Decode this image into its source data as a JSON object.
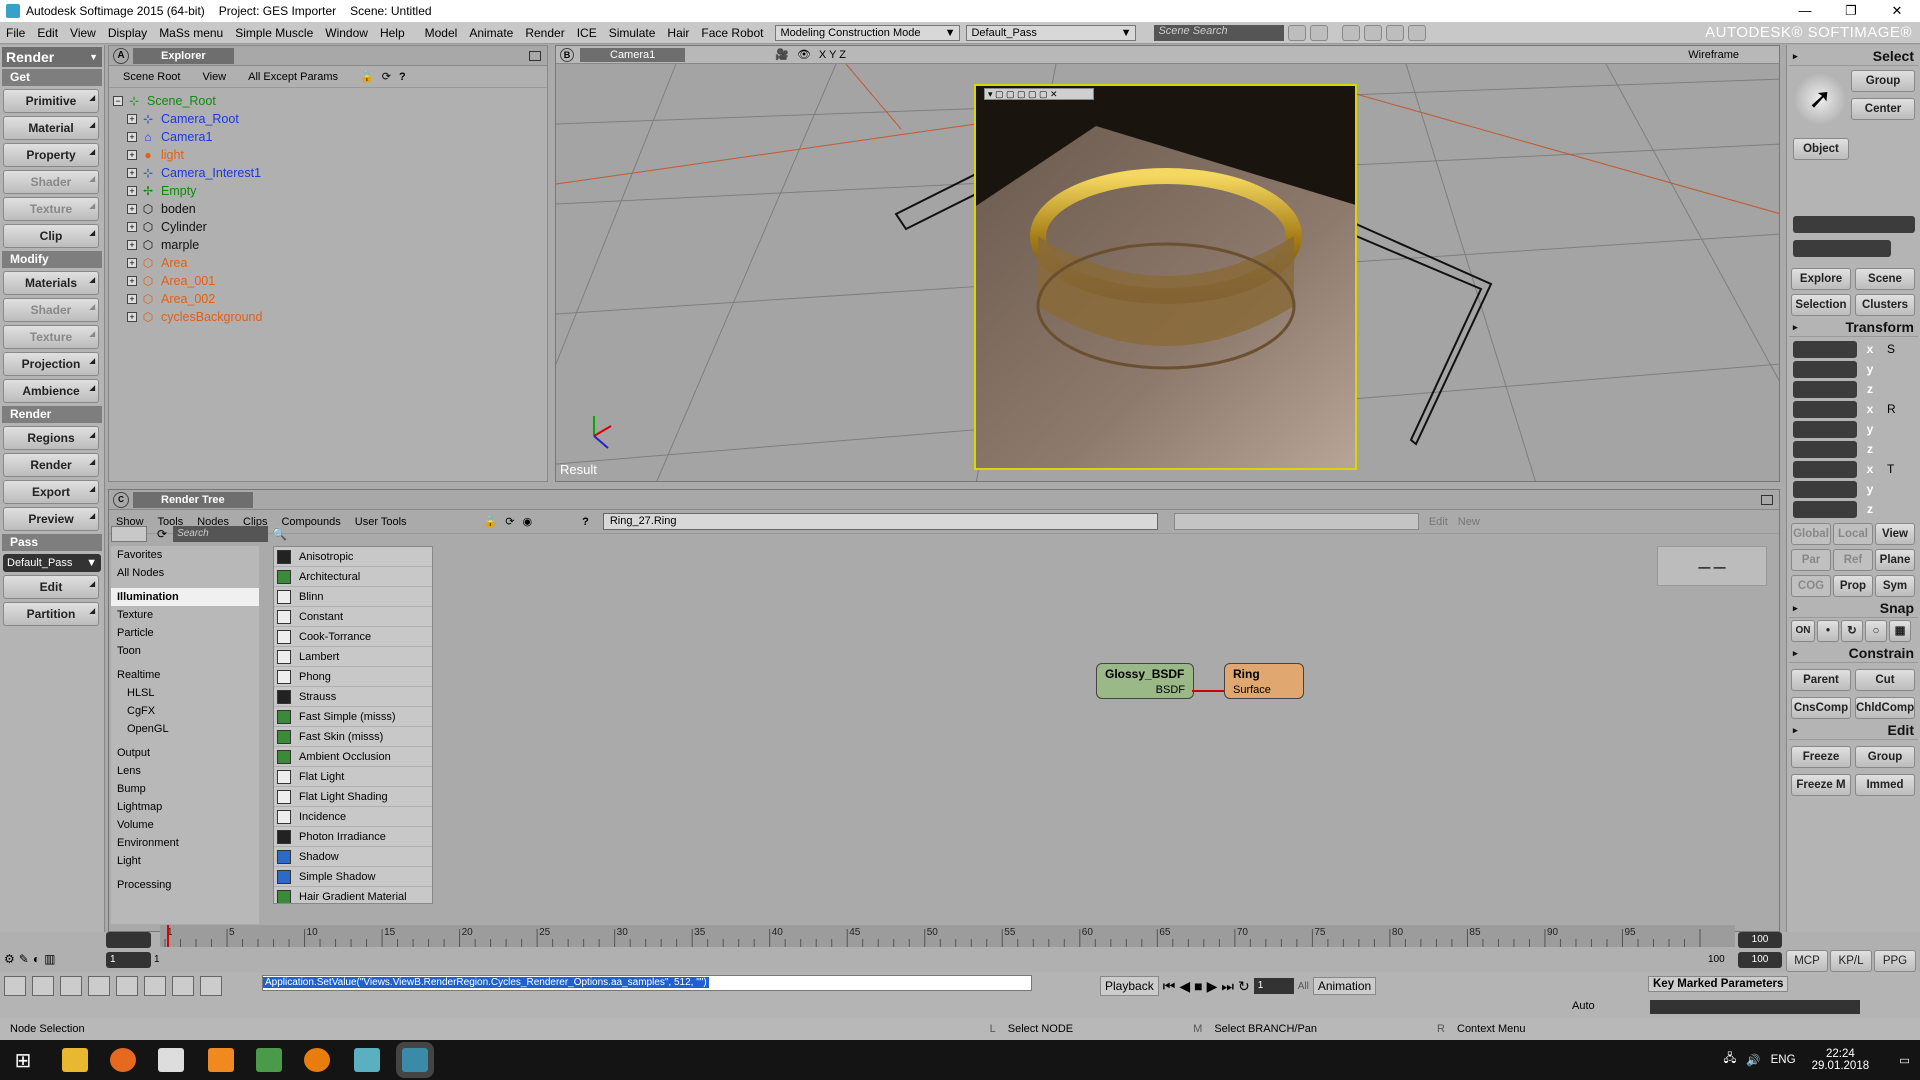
{
  "titlebar": {
    "app": "Autodesk Softimage 2015 (64-bit)",
    "project": "Project: GES Importer",
    "scene": "Scene: Untitled",
    "minimize": "—",
    "maximize": "❐",
    "close": "✕"
  },
  "menubar": {
    "items": [
      "File",
      "Edit",
      "View",
      "Display",
      "MaSs menu",
      "Simple Muscle",
      "Window",
      "Help"
    ],
    "items2": [
      "Model",
      "Animate",
      "Render",
      "ICE",
      "Simulate",
      "Hair",
      "Face Robot"
    ],
    "mode": "Modeling Construction Mode",
    "pass": "Default_Pass",
    "search_placeholder": "Scene Search",
    "brand": "AUTODESK® SOFTIMAGE®"
  },
  "left_panel": {
    "header": "Render",
    "get": "Get",
    "buttons_get": [
      {
        "label": "Primitive",
        "disabled": false
      },
      {
        "label": "Material",
        "disabled": false
      },
      {
        "label": "Property",
        "disabled": false
      },
      {
        "label": "Shader",
        "disabled": true
      },
      {
        "label": "Texture",
        "disabled": true
      },
      {
        "label": "Clip",
        "disabled": false
      }
    ],
    "modify": "Modify",
    "buttons_modify": [
      {
        "label": "Materials",
        "disabled": false
      },
      {
        "label": "Shader",
        "disabled": true
      },
      {
        "label": "Texture",
        "disabled": true
      },
      {
        "label": "Projection",
        "disabled": false
      },
      {
        "label": "Ambience",
        "disabled": false
      }
    ],
    "render": "Render",
    "buttons_render": [
      {
        "label": "Regions"
      },
      {
        "label": "Render"
      },
      {
        "label": "Export"
      },
      {
        "label": "Preview"
      }
    ],
    "pass": "Pass",
    "pass_value": "Default_Pass",
    "buttons_pass": [
      {
        "label": "Edit"
      },
      {
        "label": "Partition"
      }
    ]
  },
  "explorer": {
    "letter": "A",
    "title": "Explorer",
    "toolbar": [
      "Scene Root",
      "View",
      "All Except Params"
    ],
    "tree": [
      {
        "label": "Scene_Root",
        "color": "green",
        "icon": "⊹",
        "root": true
      },
      {
        "label": "Camera_Root",
        "color": "blue",
        "icon": "⊹"
      },
      {
        "label": "Camera1",
        "color": "blue",
        "icon": "⌂"
      },
      {
        "label": "light",
        "color": "orange",
        "icon": "●"
      },
      {
        "label": "Camera_Interest1",
        "color": "blue",
        "icon": "⊹"
      },
      {
        "label": "Empty",
        "color": "green",
        "icon": "✢"
      },
      {
        "label": "boden",
        "color": "black",
        "icon": "⬡"
      },
      {
        "label": "Cylinder",
        "color": "black",
        "icon": "⬡"
      },
      {
        "label": "marple",
        "color": "black",
        "icon": "⬡"
      },
      {
        "label": "Area",
        "color": "orange",
        "icon": "⬡"
      },
      {
        "label": "Area_001",
        "color": "orange",
        "icon": "⬡"
      },
      {
        "label": "Area_002",
        "color": "orange",
        "icon": "⬡"
      },
      {
        "label": "cyclesBackground",
        "color": "orange",
        "icon": "⬡"
      }
    ]
  },
  "viewport": {
    "letter": "B",
    "camera": "Camera1",
    "axes": "X Y Z",
    "mode": "Wireframe",
    "result": "Result"
  },
  "render_tree": {
    "title": "Render Tree",
    "menu": [
      "Show",
      "Tools",
      "Nodes",
      "Clips",
      "Compounds",
      "User Tools"
    ],
    "path": "Ring_27.Ring",
    "edit": "Edit",
    "new": "New",
    "search_placeholder": "Search",
    "categories": [
      {
        "label": "Favorites"
      },
      {
        "label": "All Nodes"
      },
      {
        "gap": true
      },
      {
        "label": "Illumination",
        "selected": true
      },
      {
        "label": "Texture"
      },
      {
        "label": "Particle"
      },
      {
        "label": "Toon"
      },
      {
        "gap": true
      },
      {
        "label": "Realtime"
      },
      {
        "label": "HLSL",
        "sub": true
      },
      {
        "label": "CgFX",
        "sub": true
      },
      {
        "label": "OpenGL",
        "sub": true
      },
      {
        "gap": true
      },
      {
        "label": "Output"
      },
      {
        "label": "Lens"
      },
      {
        "label": "Bump"
      },
      {
        "label": "Lightmap"
      },
      {
        "label": "Volume"
      },
      {
        "label": "Environment"
      },
      {
        "label": "Light"
      },
      {
        "gap": true
      },
      {
        "label": "Processing"
      }
    ],
    "nodes": [
      {
        "label": "Anisotropic",
        "icon": "k"
      },
      {
        "label": "Architectural",
        "icon": "g"
      },
      {
        "label": "Blinn",
        "icon": "w"
      },
      {
        "label": "Constant",
        "icon": "w"
      },
      {
        "label": "Cook-Torrance",
        "icon": "w"
      },
      {
        "label": "Lambert",
        "icon": "w"
      },
      {
        "label": "Phong",
        "icon": "w"
      },
      {
        "label": "Strauss",
        "icon": "k"
      },
      {
        "label": "Fast Simple (misss)",
        "icon": "g"
      },
      {
        "label": "Fast Skin (misss)",
        "icon": "g"
      },
      {
        "label": "Ambient Occlusion",
        "icon": "g"
      },
      {
        "label": "Flat Light",
        "icon": "w"
      },
      {
        "label": "Flat Light Shading",
        "icon": "w"
      },
      {
        "label": "Incidence",
        "icon": "w"
      },
      {
        "label": "Photon Irradiance",
        "icon": "k"
      },
      {
        "label": "Shadow",
        "icon": "b"
      },
      {
        "label": "Simple Shadow",
        "icon": "b"
      },
      {
        "label": "Hair Gradient Material",
        "icon": "g"
      }
    ],
    "graph_nodes": {
      "glossy": {
        "title": "Glossy_BSDF",
        "port": "BSDF"
      },
      "ring": {
        "title": "Ring",
        "port": "Surface"
      }
    },
    "minimap_label": "— —"
  },
  "right_panel": {
    "select": "Select",
    "group": "Group",
    "center": "Center",
    "object": "Object",
    "explore": "Explore",
    "scene": "Scene",
    "selection": "Selection",
    "clusters": "Clusters",
    "transform": "Transform",
    "axes": [
      "x",
      "y",
      "z"
    ],
    "tools": [
      "S",
      "R",
      "T"
    ],
    "modes1": [
      "Global",
      "Local",
      "View"
    ],
    "modes2": [
      "Par",
      "Ref",
      "Plane"
    ],
    "modes3": [
      "COG",
      "Prop",
      "Sym"
    ],
    "snap": "Snap",
    "snap_on": "ON",
    "constrain": "Constrain",
    "parent": "Parent",
    "cut": "Cut",
    "cnscomp": "CnsComp",
    "chldcomp": "ChldComp",
    "edit": "Edit",
    "freeze": "Freeze",
    "group2": "Group",
    "freezem": "Freeze M",
    "immed": "Immed",
    "tabs": [
      "MCP",
      "KP/L",
      "PPG"
    ]
  },
  "timeline": {
    "start": "1",
    "end": "100",
    "ticks": [
      "1",
      "5",
      "10",
      "15",
      "20",
      "25",
      "30",
      "35",
      "40",
      "45",
      "50",
      "55",
      "60",
      "65",
      "70",
      "75",
      "80",
      "85",
      "90",
      "95"
    ],
    "right_end": "100",
    "right_end2": "100"
  },
  "scriptbar": {
    "command": "Application.SetValue(\"Views.ViewB.RenderRegion.Cycles_Renderer_Options.aa_samples\", 512, \"\")",
    "playback": "Playback",
    "frame": "1",
    "all": "All",
    "animation": "Animation",
    "auto": "Auto",
    "key_marked": "Key Marked Parameters"
  },
  "statusbar": {
    "left": "Node Selection",
    "l_label": "L",
    "l_text": "Select NODE",
    "m_label": "M",
    "m_text": "Select BRANCH/Pan",
    "r_label": "R",
    "r_text": "Context Menu"
  },
  "taskbar": {
    "lang": "ENG",
    "time": "22:24",
    "date": "29.01.2018"
  }
}
